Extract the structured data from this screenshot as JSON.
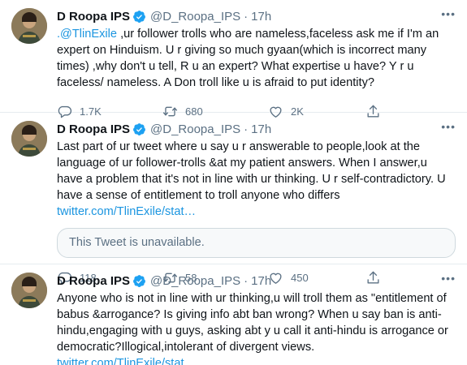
{
  "tweets": [
    {
      "name": "D Roopa IPS",
      "handle": "@D_Roopa_IPS",
      "separator": "·",
      "time": "17h",
      "mention": ".@TlinExile",
      "text": " ,ur follower trolls who are nameless,faceless ask me if I'm an expert on Hinduism. U r giving so much gyaan(which is incorrect many times) ,why don't u tell, R u an expert? What expertise u have? Y r u faceless/ nameless. A Don troll like u is afraid to put identity?",
      "replies": "1.7K",
      "retweets": "680",
      "likes": "2K"
    },
    {
      "name": "D Roopa IPS",
      "handle": "@D_Roopa_IPS",
      "separator": "·",
      "time": "17h",
      "text": "Last part of ur tweet where u say u r answerable to people,look at the language of ur follower-trolls &at my patient answers. When I answer,u have a problem that it's not in line with ur thinking. U r self-contradictory. U have a sense of entitlement to troll anyone who differs ",
      "link": "twitter.com/TlinExile/stat…",
      "quote": "This Tweet is unavailable.",
      "replies": "118",
      "retweets": "58",
      "likes": "450"
    },
    {
      "name": "D Roopa IPS",
      "handle": "@D_Roopa_IPS",
      "separator": "·",
      "time": "17h",
      "text": "Anyone who is not in line with ur thinking,u will troll them as \"entitlement of babus &arrogance? Is giving info abt ban wrong? When u say ban is anti-hindu,engaging with u guys, asking abt y u call it anti-hindu is arrogance or democratic?Illogical,intolerant of divergent views. ",
      "link": "twitter.com/TlinExile/stat…"
    }
  ],
  "colors": {
    "link": "#1b95e0",
    "verified": "#1da1f2",
    "muted": "#5b7083",
    "divider": "#e6ecf0"
  },
  "icons": [
    "verified-badge-icon",
    "more-icon",
    "reply-icon",
    "retweet-icon",
    "like-icon",
    "share-icon"
  ]
}
